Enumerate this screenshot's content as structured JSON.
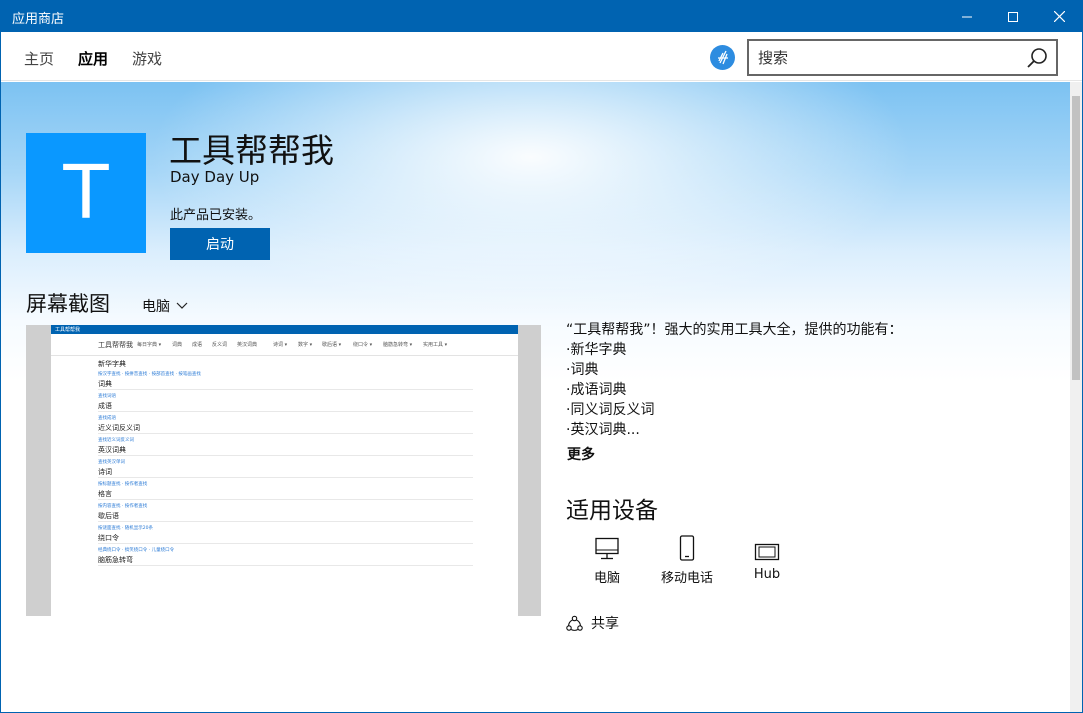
{
  "window": {
    "title": "应用商店"
  },
  "nav": {
    "tabs": [
      {
        "label": "主页",
        "active": false
      },
      {
        "label": "应用",
        "active": true
      },
      {
        "label": "游戏",
        "active": false
      }
    ],
    "search_placeholder": "搜索"
  },
  "app": {
    "icon_letter": "T",
    "icon_color": "#0a98ff",
    "title": "工具帮帮我",
    "publisher": "Day Day Up",
    "install_status": "此产品已安装。",
    "launch_label": "启动"
  },
  "screenshots": {
    "heading": "屏幕截图",
    "device_filter": "电脑",
    "thumbnail": {
      "window_title": "工具帮帮我",
      "menu_brand": "工具帮帮我",
      "menu_items": [
        "每日字典 ▾",
        "词典",
        "成语",
        "反义词",
        "英汉词典",
        "诗词 ▾",
        "数字 ▾",
        "歇后语 ▾",
        "绕口令 ▾",
        "脑筋急转弯 ▾",
        "实用工具 ▾"
      ],
      "sections": [
        {
          "heading": "新华字典",
          "links": "按汉字查找 · 按拼音查找 · 按部首查找 · 按笔画查找"
        },
        {
          "heading": "词典",
          "links": "查找词语"
        },
        {
          "heading": "成语",
          "links": "查找成语"
        },
        {
          "heading": "近义词反义词",
          "links": "查找近义词反义词"
        },
        {
          "heading": "英汉词典",
          "links": "查找英汉单词"
        },
        {
          "heading": "诗词",
          "links": "按标题查找 · 按作者查找"
        },
        {
          "heading": "格言",
          "links": "按内容查找 · 按作者查找"
        },
        {
          "heading": "歇后语",
          "links": "按谜面查找 · 随机显示20条"
        },
        {
          "heading": "绕口令",
          "links": "经典绕口令 · 搞笑绕口令 · 儿童绕口令"
        },
        {
          "heading": "脑筋急转弯",
          "links": ""
        }
      ]
    }
  },
  "description": {
    "lines": [
      "“工具帮帮我”！强大的实用工具大全，提供的功能有：",
      "·新华字典",
      "·词典",
      "·成语词典",
      "·同义词反义词",
      "·英汉词典..."
    ],
    "more_label": "更多"
  },
  "devices": {
    "heading": "适用设备",
    "items": [
      {
        "label": "电脑",
        "icon": "pc-icon"
      },
      {
        "label": "移动电话",
        "icon": "phone-icon"
      },
      {
        "label": "Hub",
        "icon": "hub-icon"
      }
    ]
  },
  "share": {
    "label": "共享"
  },
  "colors": {
    "accent": "#0063b1",
    "titlebar": "#0063b1",
    "hero_gradient_top": "#7cc2f2"
  }
}
